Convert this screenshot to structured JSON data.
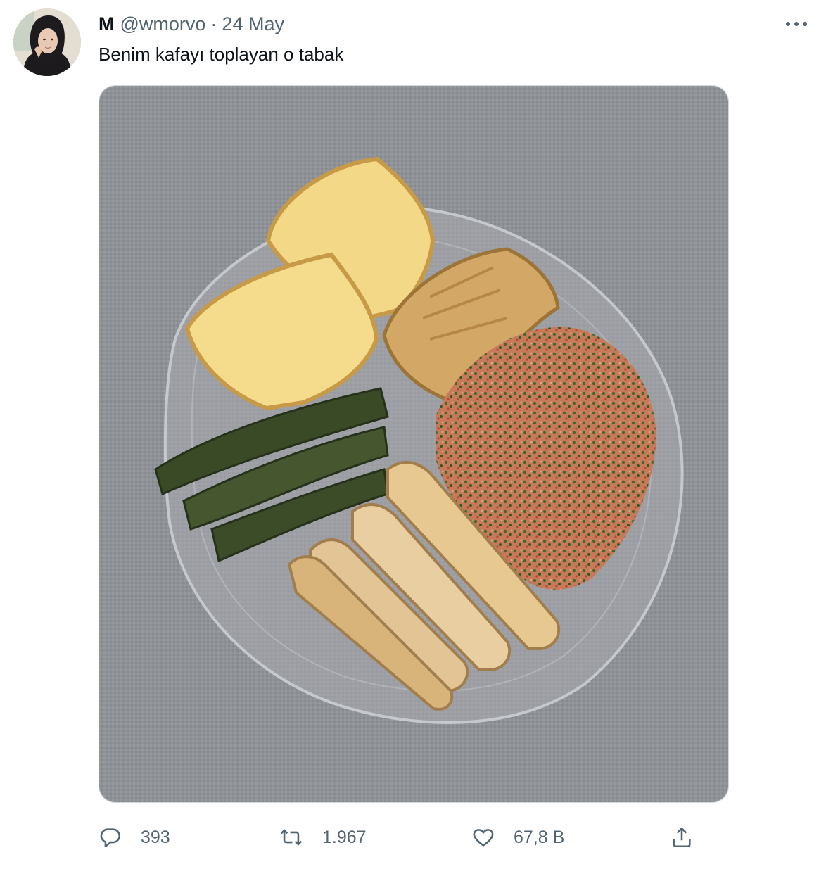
{
  "tweet": {
    "author_name": "M",
    "handle": "@wmorvo",
    "separator": "·",
    "date": "24 May",
    "text": "Benim kafayı toplayan o tabak",
    "avatar_icon": "profile-avatar",
    "more_icon": "more-horizontal-icon"
  },
  "actions": {
    "reply": {
      "icon": "reply-icon",
      "count": "393"
    },
    "retweet": {
      "icon": "retweet-icon",
      "count": "1.967"
    },
    "like": {
      "icon": "heart-icon",
      "count": "67,8 B"
    },
    "share": {
      "icon": "share-icon"
    }
  },
  "colors": {
    "text_primary": "#0f1419",
    "text_secondary": "#536471",
    "border": "#cfd9de"
  }
}
